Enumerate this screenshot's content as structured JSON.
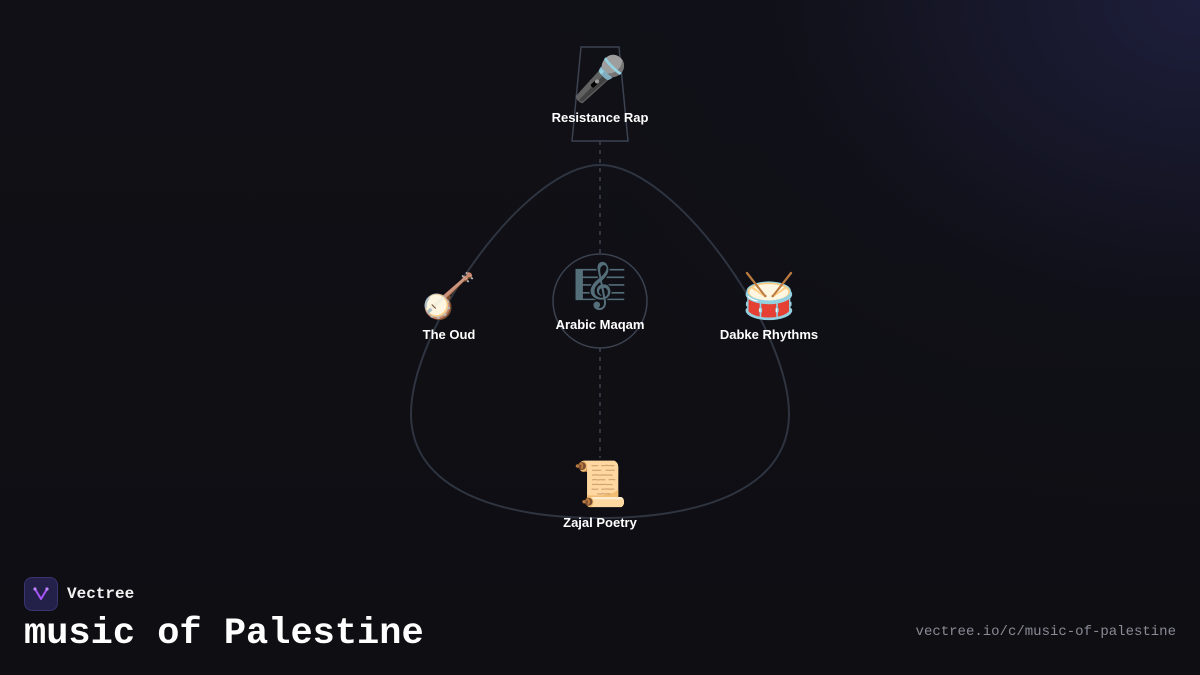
{
  "brand": {
    "name": "Vectree",
    "logo_icon": "vectree-logo-icon"
  },
  "title": "music of Palestine",
  "url": "vectree.io/c/music-of-palestine",
  "colors": {
    "background": "#0f0f14",
    "outline": "#2e3440",
    "text": "#ffffff",
    "muted": "#8a8a95",
    "accent": "#a855f7"
  },
  "nodes": {
    "top": {
      "label": "Resistance Rap",
      "icon": "🎤",
      "icon_name": "microphone-icon"
    },
    "center": {
      "label": "Arabic Maqam",
      "icon": "🎼",
      "icon_name": "musical-score-icon"
    },
    "left": {
      "label": "The Oud",
      "icon": "🪕",
      "icon_name": "banjo-icon"
    },
    "right": {
      "label": "Dabke Rhythms",
      "icon": "🥁",
      "icon_name": "drum-icon"
    },
    "bottom": {
      "label": "Zajal Poetry",
      "icon": "📜",
      "icon_name": "scroll-icon"
    }
  }
}
